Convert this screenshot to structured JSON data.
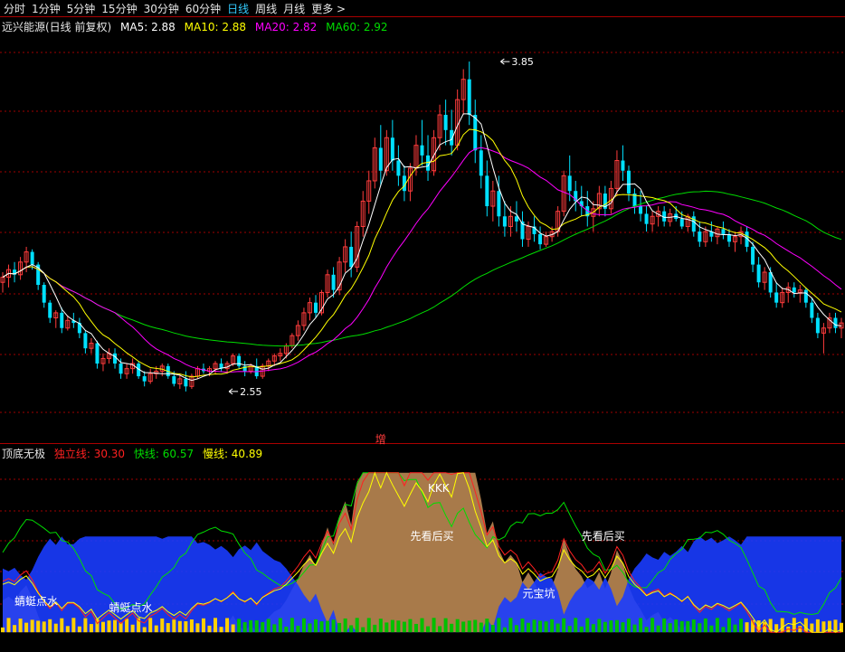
{
  "tabs": [
    {
      "label": "分时",
      "active": false
    },
    {
      "label": "1分钟",
      "active": false
    },
    {
      "label": "5分钟",
      "active": false
    },
    {
      "label": "15分钟",
      "active": false
    },
    {
      "label": "30分钟",
      "active": false
    },
    {
      "label": "60分钟",
      "active": false
    },
    {
      "label": "日线",
      "active": true
    },
    {
      "label": "周线",
      "active": false
    },
    {
      "label": "月线",
      "active": false
    },
    {
      "label": "更多 >",
      "active": false
    }
  ],
  "main_legend": {
    "name": "远兴能源(日线 前复权)",
    "ma5": "MA5: 2.88",
    "ma10": "MA10: 2.88",
    "ma20": "MA20: 2.82",
    "ma60": "MA60: 2.92"
  },
  "sub_legend": {
    "name": "顶底无极",
    "dulixian": "独立线: 30.30",
    "kuaixian": "快线: 60.57",
    "manxian": "慢线: 40.89"
  },
  "colors": {
    "up": "#ff3c3c",
    "down": "#00e0ff",
    "ma5": "#ffffff",
    "ma10": "#ffff00",
    "ma20": "#ff00ff",
    "ma60": "#00dd00",
    "brown": "#a87a4a",
    "blue": "#1a3cff",
    "gridline": "#a00000"
  },
  "chart_data": [
    {
      "type": "candlestick",
      "title": "远兴能源(日线 前复权)",
      "ylim": [
        2.4,
        3.95
      ],
      "annotations": [
        {
          "label": "3.85",
          "x": 84,
          "y": 3.85
        },
        {
          "label": "2.55",
          "x": 38,
          "y": 2.55
        },
        {
          "label": "增",
          "x": 64,
          "y": 2.4
        }
      ],
      "candles": [
        [
          2.98,
          3.02,
          2.94,
          3.0
        ],
        [
          3.0,
          3.05,
          2.96,
          3.03
        ],
        [
          3.03,
          3.06,
          2.98,
          3.01
        ],
        [
          3.01,
          3.08,
          2.99,
          3.06
        ],
        [
          3.06,
          3.12,
          3.02,
          3.1
        ],
        [
          3.1,
          3.11,
          3.03,
          3.05
        ],
        [
          3.05,
          3.06,
          2.95,
          2.97
        ],
        [
          2.97,
          2.98,
          2.88,
          2.9
        ],
        [
          2.9,
          2.91,
          2.82,
          2.84
        ],
        [
          2.84,
          2.87,
          2.8,
          2.86
        ],
        [
          2.86,
          2.88,
          2.78,
          2.8
        ],
        [
          2.8,
          2.85,
          2.79,
          2.83
        ],
        [
          2.83,
          2.86,
          2.8,
          2.82
        ],
        [
          2.82,
          2.84,
          2.76,
          2.78
        ],
        [
          2.78,
          2.79,
          2.7,
          2.72
        ],
        [
          2.72,
          2.76,
          2.7,
          2.74
        ],
        [
          2.74,
          2.75,
          2.64,
          2.66
        ],
        [
          2.66,
          2.7,
          2.63,
          2.68
        ],
        [
          2.68,
          2.72,
          2.66,
          2.7
        ],
        [
          2.7,
          2.72,
          2.64,
          2.66
        ],
        [
          2.66,
          2.68,
          2.6,
          2.62
        ],
        [
          2.62,
          2.66,
          2.6,
          2.64
        ],
        [
          2.64,
          2.68,
          2.62,
          2.66
        ],
        [
          2.66,
          2.67,
          2.6,
          2.61
        ],
        [
          2.61,
          2.63,
          2.57,
          2.59
        ],
        [
          2.59,
          2.64,
          2.58,
          2.62
        ],
        [
          2.62,
          2.65,
          2.6,
          2.63
        ],
        [
          2.63,
          2.66,
          2.61,
          2.65
        ],
        [
          2.65,
          2.66,
          2.6,
          2.61
        ],
        [
          2.61,
          2.63,
          2.57,
          2.58
        ],
        [
          2.58,
          2.62,
          2.56,
          2.6
        ],
        [
          2.6,
          2.63,
          2.55,
          2.57
        ],
        [
          2.57,
          2.62,
          2.56,
          2.61
        ],
        [
          2.61,
          2.65,
          2.6,
          2.64
        ],
        [
          2.64,
          2.66,
          2.62,
          2.63
        ],
        [
          2.63,
          2.65,
          2.61,
          2.64
        ],
        [
          2.64,
          2.67,
          2.62,
          2.66
        ],
        [
          2.66,
          2.68,
          2.63,
          2.64
        ],
        [
          2.64,
          2.67,
          2.62,
          2.66
        ],
        [
          2.66,
          2.7,
          2.65,
          2.69
        ],
        [
          2.69,
          2.7,
          2.64,
          2.65
        ],
        [
          2.65,
          2.67,
          2.61,
          2.63
        ],
        [
          2.63,
          2.66,
          2.62,
          2.65
        ],
        [
          2.65,
          2.68,
          2.6,
          2.61
        ],
        [
          2.61,
          2.66,
          2.6,
          2.65
        ],
        [
          2.65,
          2.68,
          2.63,
          2.67
        ],
        [
          2.67,
          2.7,
          2.65,
          2.69
        ],
        [
          2.69,
          2.72,
          2.67,
          2.7
        ],
        [
          2.7,
          2.74,
          2.68,
          2.73
        ],
        [
          2.73,
          2.78,
          2.72,
          2.77
        ],
        [
          2.77,
          2.83,
          2.75,
          2.81
        ],
        [
          2.81,
          2.88,
          2.79,
          2.86
        ],
        [
          2.86,
          2.92,
          2.83,
          2.9
        ],
        [
          2.9,
          2.93,
          2.84,
          2.86
        ],
        [
          2.86,
          2.95,
          2.85,
          2.94
        ],
        [
          2.94,
          3.03,
          2.92,
          3.01
        ],
        [
          3.01,
          3.04,
          2.92,
          2.95
        ],
        [
          2.95,
          3.08,
          2.93,
          3.06
        ],
        [
          3.06,
          3.15,
          3.02,
          3.12
        ],
        [
          3.12,
          3.18,
          3.0,
          3.04
        ],
        [
          3.04,
          3.22,
          3.02,
          3.2
        ],
        [
          3.2,
          3.34,
          3.16,
          3.3
        ],
        [
          3.3,
          3.42,
          3.25,
          3.38
        ],
        [
          3.38,
          3.55,
          3.35,
          3.51
        ],
        [
          3.51,
          3.6,
          3.36,
          3.42
        ],
        [
          3.42,
          3.58,
          3.4,
          3.55
        ],
        [
          3.55,
          3.62,
          3.42,
          3.46
        ],
        [
          3.46,
          3.52,
          3.36,
          3.4
        ],
        [
          3.4,
          3.44,
          3.3,
          3.34
        ],
        [
          3.34,
          3.45,
          3.3,
          3.43
        ],
        [
          3.43,
          3.56,
          3.4,
          3.52
        ],
        [
          3.52,
          3.62,
          3.44,
          3.48
        ],
        [
          3.48,
          3.56,
          3.38,
          3.42
        ],
        [
          3.42,
          3.58,
          3.4,
          3.55
        ],
        [
          3.55,
          3.68,
          3.5,
          3.64
        ],
        [
          3.64,
          3.7,
          3.52,
          3.58
        ],
        [
          3.58,
          3.66,
          3.48,
          3.52
        ],
        [
          3.52,
          3.74,
          3.5,
          3.7
        ],
        [
          3.7,
          3.82,
          3.64,
          3.78
        ],
        [
          3.78,
          3.85,
          3.6,
          3.64
        ],
        [
          3.64,
          3.7,
          3.45,
          3.5
        ],
        [
          3.5,
          3.56,
          3.35,
          3.4
        ],
        [
          3.4,
          3.46,
          3.24,
          3.28
        ],
        [
          3.28,
          3.38,
          3.22,
          3.34
        ],
        [
          3.34,
          3.4,
          3.2,
          3.24
        ],
        [
          3.24,
          3.3,
          3.16,
          3.2
        ],
        [
          3.2,
          3.28,
          3.16,
          3.24
        ],
        [
          3.24,
          3.3,
          3.18,
          3.22
        ],
        [
          3.22,
          3.26,
          3.12,
          3.15
        ],
        [
          3.15,
          3.22,
          3.12,
          3.2
        ],
        [
          3.2,
          3.24,
          3.14,
          3.17
        ],
        [
          3.17,
          3.2,
          3.11,
          3.13
        ],
        [
          3.13,
          3.18,
          3.12,
          3.16
        ],
        [
          3.16,
          3.2,
          3.14,
          3.18
        ],
        [
          3.18,
          3.28,
          3.16,
          3.26
        ],
        [
          3.26,
          3.42,
          3.24,
          3.4
        ],
        [
          3.4,
          3.48,
          3.3,
          3.34
        ],
        [
          3.34,
          3.38,
          3.26,
          3.3
        ],
        [
          3.3,
          3.36,
          3.24,
          3.28
        ],
        [
          3.28,
          3.34,
          3.2,
          3.24
        ],
        [
          3.24,
          3.3,
          3.18,
          3.27
        ],
        [
          3.27,
          3.36,
          3.24,
          3.33
        ],
        [
          3.33,
          3.36,
          3.24,
          3.27
        ],
        [
          3.27,
          3.38,
          3.25,
          3.35
        ],
        [
          3.35,
          3.5,
          3.32,
          3.46
        ],
        [
          3.46,
          3.52,
          3.38,
          3.42
        ],
        [
          3.42,
          3.44,
          3.3,
          3.33
        ],
        [
          3.33,
          3.35,
          3.25,
          3.28
        ],
        [
          3.28,
          3.34,
          3.22,
          3.25
        ],
        [
          3.25,
          3.28,
          3.18,
          3.21
        ],
        [
          3.21,
          3.26,
          3.18,
          3.24
        ],
        [
          3.24,
          3.28,
          3.2,
          3.26
        ],
        [
          3.26,
          3.28,
          3.2,
          3.22
        ],
        [
          3.22,
          3.27,
          3.2,
          3.25
        ],
        [
          3.25,
          3.28,
          3.22,
          3.23
        ],
        [
          3.23,
          3.26,
          3.19,
          3.2
        ],
        [
          3.2,
          3.25,
          3.18,
          3.24
        ],
        [
          3.24,
          3.26,
          3.16,
          3.18
        ],
        [
          3.18,
          3.22,
          3.12,
          3.14
        ],
        [
          3.14,
          3.2,
          3.12,
          3.18
        ],
        [
          3.18,
          3.22,
          3.14,
          3.16
        ],
        [
          3.16,
          3.2,
          3.13,
          3.19
        ],
        [
          3.19,
          3.22,
          3.15,
          3.17
        ],
        [
          3.17,
          3.19,
          3.12,
          3.14
        ],
        [
          3.14,
          3.18,
          3.1,
          3.16
        ],
        [
          3.16,
          3.2,
          3.13,
          3.18
        ],
        [
          3.18,
          3.2,
          3.1,
          3.12
        ],
        [
          3.12,
          3.14,
          3.02,
          3.05
        ],
        [
          3.05,
          3.08,
          2.96,
          2.98
        ],
        [
          2.98,
          3.04,
          2.95,
          3.02
        ],
        [
          3.02,
          3.04,
          2.92,
          2.94
        ],
        [
          2.94,
          2.98,
          2.88,
          2.9
        ],
        [
          2.9,
          2.96,
          2.88,
          2.94
        ],
        [
          2.94,
          2.98,
          2.9,
          2.96
        ],
        [
          2.96,
          2.98,
          2.92,
          2.94
        ],
        [
          2.94,
          2.97,
          2.9,
          2.95
        ],
        [
          2.95,
          2.96,
          2.88,
          2.9
        ],
        [
          2.9,
          2.92,
          2.82,
          2.84
        ],
        [
          2.84,
          2.86,
          2.76,
          2.78
        ],
        [
          2.78,
          2.82,
          2.7,
          2.8
        ],
        [
          2.8,
          2.86,
          2.78,
          2.84
        ],
        [
          2.84,
          2.86,
          2.78,
          2.8
        ],
        [
          2.8,
          2.84,
          2.76,
          2.82
        ]
      ]
    },
    {
      "type": "line",
      "title": "顶底无极",
      "ylim": [
        -5,
        110
      ],
      "annotations": [
        {
          "label": "KKK",
          "x": 72,
          "y": 88
        },
        {
          "label": "先看后买",
          "x": 69,
          "y": 58
        },
        {
          "label": "先看后买",
          "x": 98,
          "y": 58
        },
        {
          "label": "元宝坑",
          "x": 88,
          "y": 22
        },
        {
          "label": "蜻蜓点水",
          "x": 2,
          "y": 17
        },
        {
          "label": "蜻蜓点水",
          "x": 18,
          "y": 13
        }
      ],
      "series": [
        {
          "name": "独立线",
          "color": "#ff2020"
        },
        {
          "name": "快线",
          "color": "#00dd00"
        },
        {
          "name": "慢线",
          "color": "#ffff00"
        }
      ]
    }
  ]
}
